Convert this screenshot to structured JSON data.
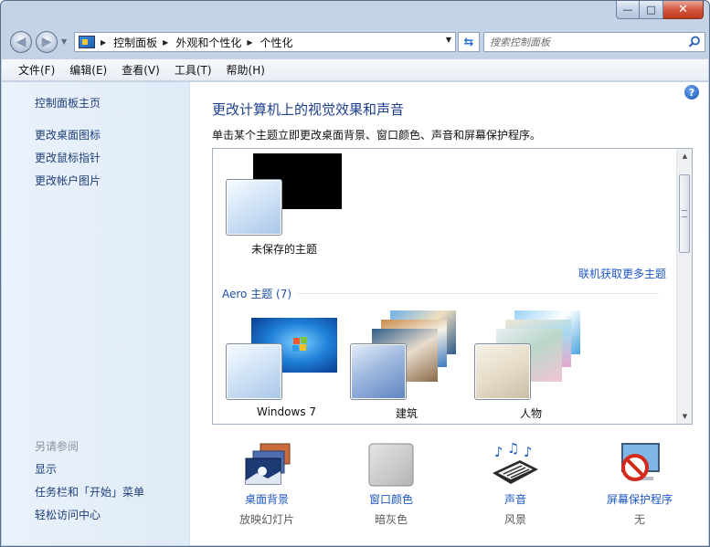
{
  "window": {
    "caption_buttons": {
      "minimize": "—",
      "maximize": "□",
      "close": "✕"
    }
  },
  "address": {
    "breadcrumbs": [
      "控制面板",
      "外观和个性化",
      "个性化"
    ],
    "search_placeholder": "搜索控制面板"
  },
  "menu": [
    "文件(F)",
    "编辑(E)",
    "查看(V)",
    "工具(T)",
    "帮助(H)"
  ],
  "sidebar": {
    "home_link": "控制面板主页",
    "links": [
      "更改桌面图标",
      "更改鼠标指针",
      "更改帐户图片"
    ],
    "see_also_heading": "另请参阅",
    "see_also": [
      "显示",
      "任务栏和「开始」菜单",
      "轻松访问中心"
    ]
  },
  "main": {
    "title": "更改计算机上的视觉效果和声音",
    "description": "单击某个主题立即更改桌面背景、窗口颜色、声音和屏幕保护程序。",
    "unsaved_theme": "未保存的主题",
    "more_themes_link": "联机获取更多主题",
    "aero_group": "Aero 主题 (7)",
    "aero_themes": [
      "Windows 7",
      "建筑",
      "人物"
    ]
  },
  "settings": [
    {
      "label": "桌面背景",
      "value": "放映幻灯片",
      "icon": "desktop-background-icon"
    },
    {
      "label": "窗口颜色",
      "value": "暗灰色",
      "icon": "window-color-icon"
    },
    {
      "label": "声音",
      "value": "风景",
      "icon": "sounds-icon"
    },
    {
      "label": "屏幕保护程序",
      "value": "无",
      "icon": "screen-saver-icon"
    }
  ],
  "colors": {
    "link": "#1e56c4",
    "title": "#1d3f8c",
    "sidebar_bg": "#e6eff9",
    "window_color_swatch": "#c7c7c7"
  }
}
